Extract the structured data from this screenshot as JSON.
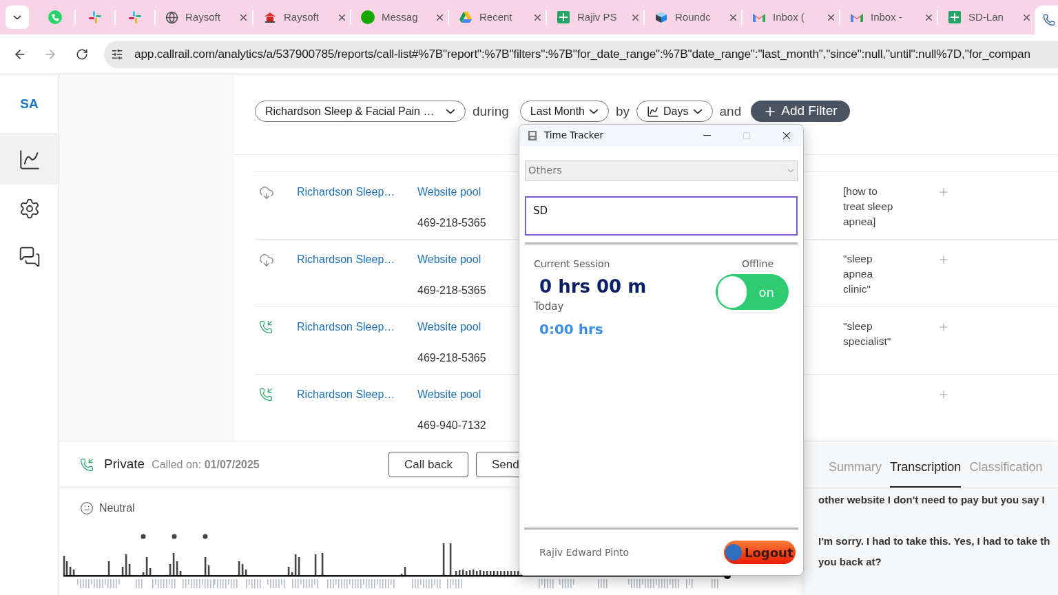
{
  "browser": {
    "tabs": [
      {
        "kind": "whatsapp",
        "selected": false
      },
      {
        "kind": "slack",
        "selected": false
      },
      {
        "kind": "slack",
        "selected": false
      },
      {
        "kind": "globe",
        "title": "Raysoft",
        "selected": false
      },
      {
        "kind": "raysoft",
        "title": "Raysoft",
        "selected": false
      },
      {
        "kind": "upwork",
        "title": "Messag",
        "selected": false
      },
      {
        "kind": "drive",
        "title": "Recent",
        "selected": false
      },
      {
        "kind": "sheets",
        "title": "Rajiv PS",
        "selected": false
      },
      {
        "kind": "roundcube",
        "title": "Roundc",
        "selected": false
      },
      {
        "kind": "gmail",
        "title": "Inbox (",
        "selected": false
      },
      {
        "kind": "gmail",
        "title": "Inbox -",
        "selected": false
      },
      {
        "kind": "sheets",
        "title": "SD-Lan",
        "selected": false
      },
      {
        "kind": "phone",
        "selected": true
      }
    ],
    "url": "app.callrail.com/analytics/a/537900785/reports/call-list#%7B\"report\":%7B\"filters\":%7B\"for_date_range\":%7B\"date_range\":\"last_month\",\"since\":null,\"until\":null%7D,\"for_compan"
  },
  "sidebar": {
    "logo": "SA",
    "items": [
      {
        "kind": "chart",
        "selected": true
      },
      {
        "kind": "settings",
        "selected": false
      },
      {
        "kind": "messages",
        "selected": false
      }
    ]
  },
  "filters": {
    "company": "Richardson Sleep & Facial Pain …",
    "during": "during",
    "range": "Last Month",
    "by": "by",
    "interval": "Days",
    "and": "and",
    "add_button": "Add Filter"
  },
  "calls": [
    {
      "kind": "recording",
      "company": "Richardson Sleep…",
      "source": "Website pool",
      "number": "469-218-5365",
      "keyword": "[how to treat sleep apnea]"
    },
    {
      "kind": "recording",
      "company": "Richardson Sleep…",
      "source": "Website pool",
      "number": "469-218-5365",
      "keyword": "\"sleep apnea clinic\""
    },
    {
      "kind": "incoming",
      "company": "Richardson Sleep…",
      "source": "Website pool",
      "number": "469-218-5365",
      "keyword": "\"sleep specialist\""
    },
    {
      "kind": "incoming",
      "company": "Richardson Sleep…",
      "source": "Website pool",
      "number": "469-940-7132"
    }
  ],
  "detail": {
    "caller": "Private",
    "called_on": "Called on: **01/07/2025**",
    "buttons": [
      "Call back",
      "Send"
    ],
    "sentiment": "Neutral",
    "tabs": [
      {
        "label": "Summary",
        "selected": false
      },
      {
        "label": "Transcription",
        "selected": true
      },
      {
        "label": "Classification",
        "selected": false
      }
    ],
    "transcript": [
      [
        "other website I don't need to pay but you say I"
      ],
      [
        "I'm sorry. I had to take this. Yes, I had to take th",
        "you back at?"
      ]
    ]
  },
  "tracker": {
    "title": "Time Tracker",
    "category": "Others",
    "task": "SD",
    "session_label": "Current Session",
    "status": "Offline",
    "session": "0 hrs 00 m",
    "toggle": {
      "on": true,
      "label": "on"
    },
    "today_label": "Today",
    "today": "0:00 hrs",
    "user": "Rajiv Edward Pinto",
    "logout": "Logout"
  }
}
